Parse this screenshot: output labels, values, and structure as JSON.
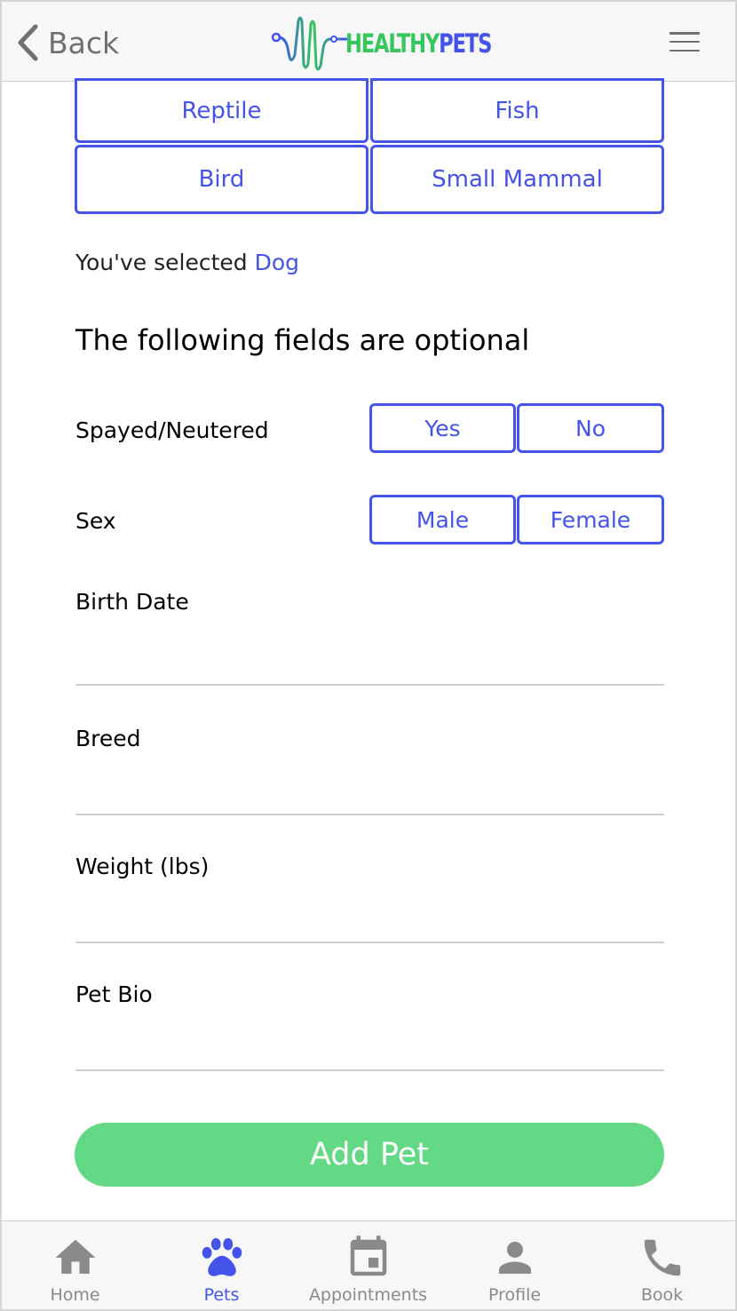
{
  "header": {
    "back_label": "Back",
    "logo": {
      "healthy": "HEALTHY",
      "pets": "PETS"
    },
    "menu_icon": "hamburger-menu-icon"
  },
  "species_options": [
    "Reptile",
    "Fish",
    "Bird",
    "Small Mammal"
  ],
  "selection": {
    "prefix": "You've selected ",
    "value": "Dog"
  },
  "optional_heading": "The following fields are optional",
  "spayed": {
    "label": "Spayed/Neutered",
    "yes": "Yes",
    "no": "No"
  },
  "sex": {
    "label": "Sex",
    "male": "Male",
    "female": "Female"
  },
  "fields": {
    "birth_date": {
      "label": "Birth Date",
      "value": ""
    },
    "breed": {
      "label": "Breed",
      "value": ""
    },
    "weight": {
      "label": "Weight (lbs)",
      "value": ""
    },
    "bio": {
      "label": "Pet Bio",
      "value": ""
    }
  },
  "add_button": "Add Pet",
  "nav": {
    "home": "Home",
    "pets": "Pets",
    "appointments": "Appointments",
    "profile": "Profile",
    "book": "Book"
  },
  "colors": {
    "primary": "#4453e8",
    "accent_green": "#63d985",
    "logo_green": "#36c75c",
    "muted": "#8a8a8a"
  }
}
